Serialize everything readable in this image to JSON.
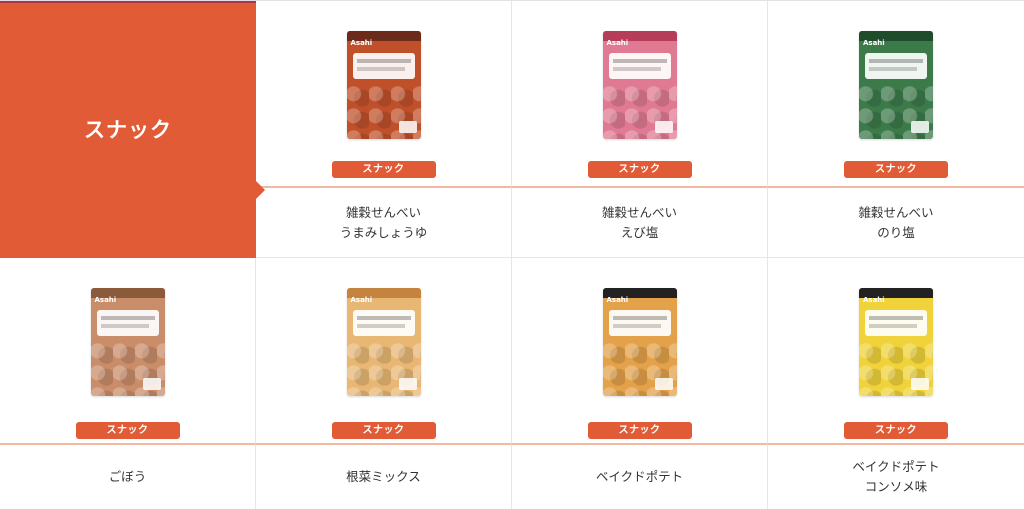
{
  "category": {
    "title": "スナック"
  },
  "colors": {
    "accent": "#e15b36",
    "divider": "#f0b9a3"
  },
  "products": [
    {
      "name": "雑穀せんべい\nうまみしょうゆ",
      "tag": "スナック",
      "pkg_color": "#c0502a",
      "band_color": "#6b2a1a",
      "image_label": "うまみしょうゆ 雑穀せんべい"
    },
    {
      "name": "雑穀せんべい\nえび塩",
      "tag": "スナック",
      "pkg_color": "#e07a92",
      "band_color": "#b53d5a",
      "image_label": "えび塩 雑穀せんべい"
    },
    {
      "name": "雑穀せんべい\nのり塩",
      "tag": "スナック",
      "pkg_color": "#3c7a4a",
      "band_color": "#1f4d2c",
      "image_label": "のり塩 雑穀せんべい"
    },
    {
      "name": "ごぼう",
      "tag": "スナック",
      "pkg_color": "#c98d6a",
      "band_color": "#8a5a3a",
      "image_label": "ごぼう"
    },
    {
      "name": "根菜ミックス",
      "tag": "スナック",
      "pkg_color": "#e8b774",
      "band_color": "#c4843f",
      "image_label": "根菜"
    },
    {
      "name": "ベイクドポテト",
      "tag": "スナック",
      "pkg_color": "#e3a24a",
      "band_color": "#222222",
      "image_label": "ベイクドポテト"
    },
    {
      "name": "ベイクドポテト\nコンソメ味",
      "tag": "スナック",
      "pkg_color": "#f0d33a",
      "band_color": "#222222",
      "image_label": "ベイクドポテト"
    }
  ]
}
